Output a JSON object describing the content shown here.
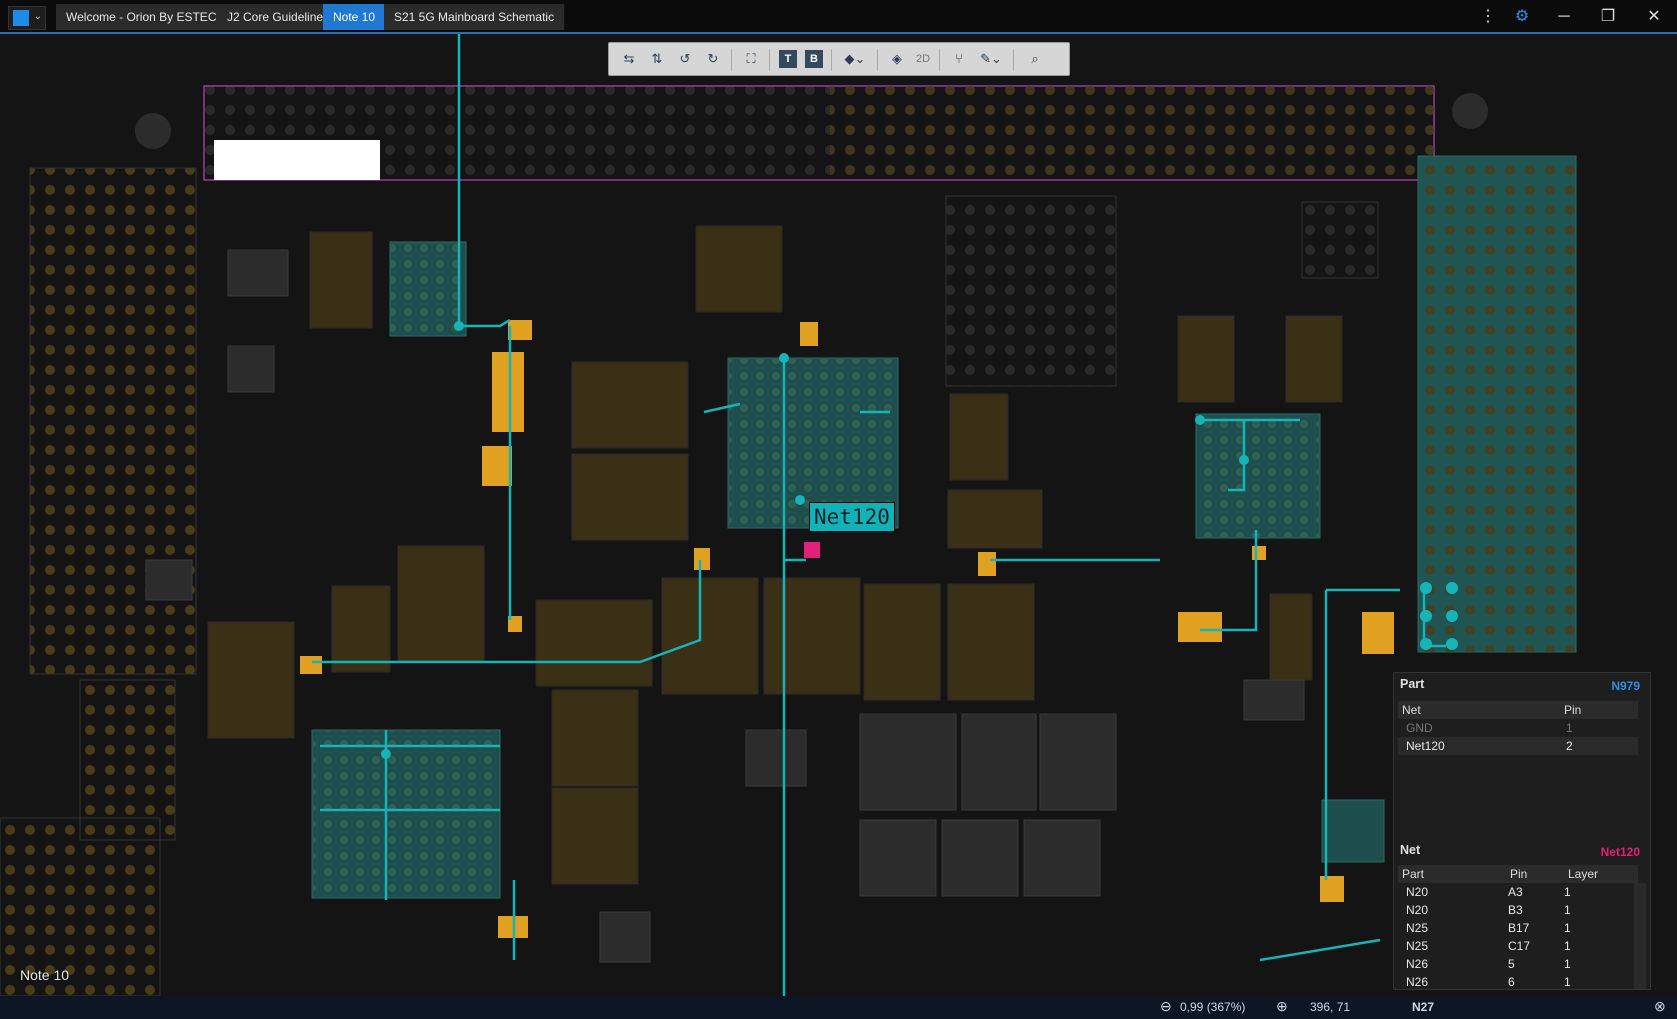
{
  "titlebar": {
    "tabs": [
      {
        "label": "Welcome - Orion By ESTECH",
        "active": false
      },
      {
        "label": "J2 Core Guideline",
        "active": false
      },
      {
        "label": "Note 10",
        "active": true
      },
      {
        "label": "S21 5G Mainboard Schematic",
        "active": false
      }
    ],
    "menu_icon": "more-vertical-icon",
    "settings_icon": "gear-icon",
    "minimize": "─",
    "restore": "❐",
    "close": "✕"
  },
  "toolbar": {
    "buttons": [
      "flip-horizontal-icon",
      "flip-vertical-icon",
      "rotate-left-icon",
      "rotate-right-icon",
      "fit-view-icon",
      "top-layer-icon",
      "bottom-layer-icon",
      "layers-icon",
      "component-icon",
      "2d-icon",
      "net-route-icon",
      "probe-icon",
      "search-icon"
    ],
    "top_label": "T",
    "bottom_label": "B",
    "mode_label": "2D"
  },
  "canvas": {
    "net_label": "Net120",
    "document_label": "Note 10"
  },
  "part_panel": {
    "title": "Part",
    "part_id": "N979",
    "columns": [
      "Net",
      "Pin"
    ],
    "rows": [
      {
        "net": "GND",
        "pin": "1"
      },
      {
        "net": "Net120",
        "pin": "2"
      }
    ]
  },
  "net_panel": {
    "title": "Net",
    "net_id": "Net120",
    "columns": [
      "Part",
      "Pin",
      "Layer"
    ],
    "rows": [
      {
        "part": "N20",
        "pin": "A3",
        "layer": "1"
      },
      {
        "part": "N20",
        "pin": "B3",
        "layer": "1"
      },
      {
        "part": "N25",
        "pin": "B17",
        "layer": "1"
      },
      {
        "part": "N25",
        "pin": "C17",
        "layer": "1"
      },
      {
        "part": "N26",
        "pin": "5",
        "layer": "1"
      },
      {
        "part": "N26",
        "pin": "6",
        "layer": "1"
      }
    ]
  },
  "statusbar": {
    "zoom": "0,99 (367%)",
    "coords": "396, 71",
    "part": "N27"
  },
  "colors": {
    "accent": "#1f78d1",
    "trace": "#16b3b8",
    "pad": "#e0a020",
    "net_highlight": "#e0207a"
  }
}
